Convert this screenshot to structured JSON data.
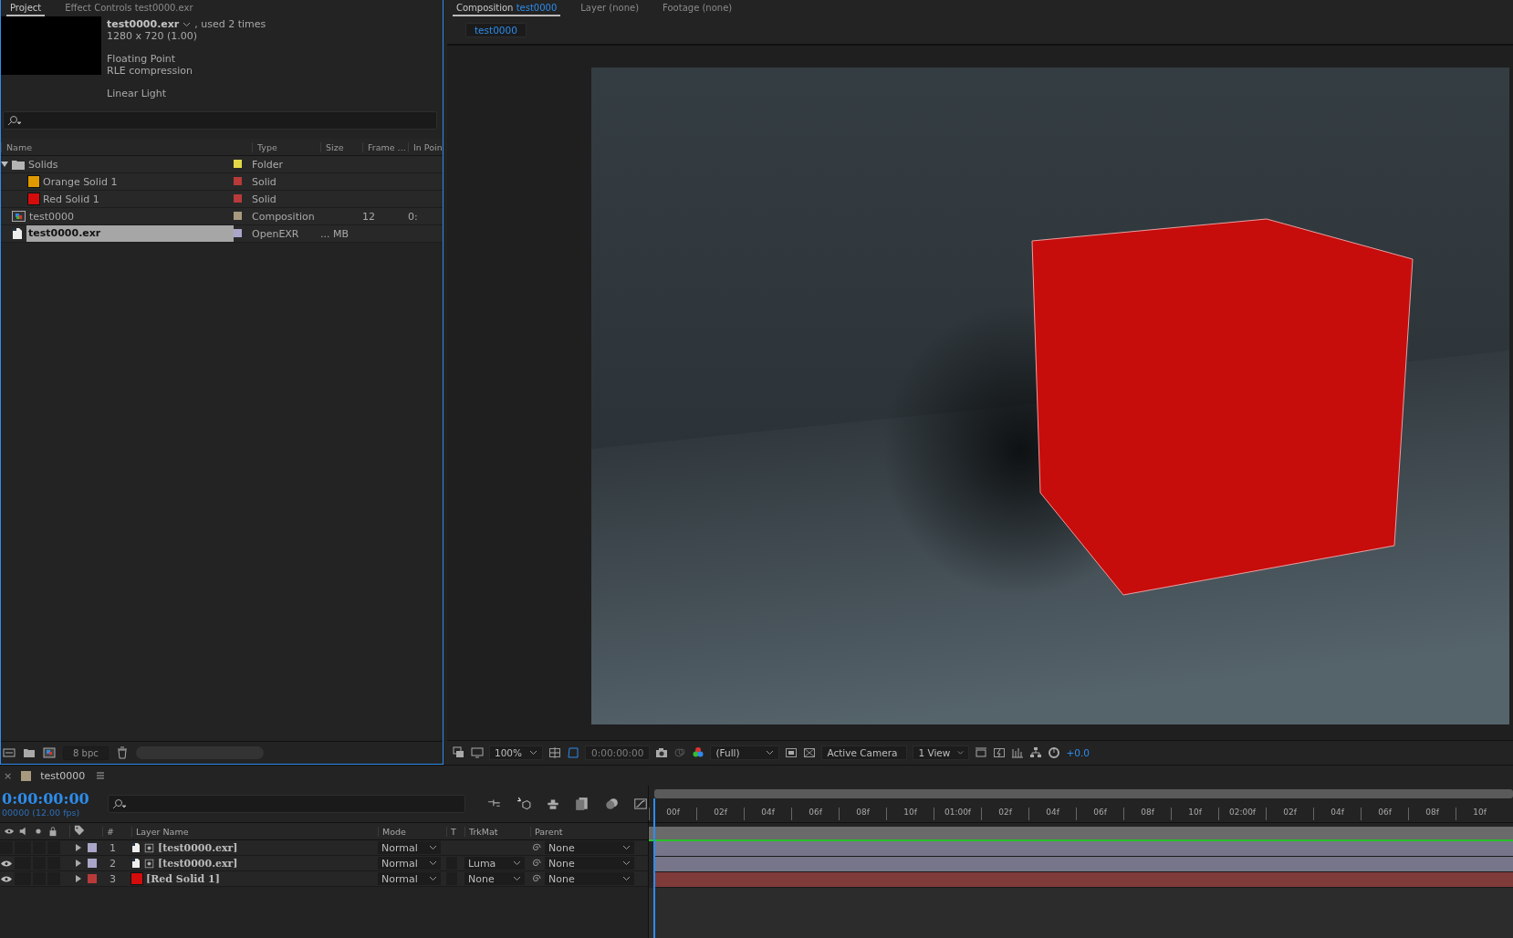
{
  "panel_tabs": [
    {
      "label": "Project",
      "selected": true
    },
    {
      "label": "Effect Controls test0000.exr",
      "selected": false
    }
  ],
  "viewer_tabs": [
    {
      "label": "Composition",
      "target": "test0000",
      "selected": true
    },
    {
      "label": "Layer (none)",
      "selected": false
    },
    {
      "label": "Footage (none)",
      "selected": false
    }
  ],
  "footage_info": {
    "name": "test0000.exr",
    "usage": ", used 2 times",
    "line_groups": [
      [
        "1280 x 720 (1.00)"
      ],
      [
        "Floating Point",
        "RLE compression"
      ],
      [
        "Linear Light"
      ]
    ]
  },
  "project": {
    "columns": [
      "Name",
      "Type",
      "Size",
      "Frame ...",
      "In Poin"
    ],
    "items": [
      {
        "name": "Solids",
        "kind": "folder",
        "expanded": true,
        "color": "#e2d847",
        "type": "Folder",
        "selected": false,
        "children": [
          {
            "name": "Orange Solid 1",
            "kind": "solid",
            "swatch": {
              "color": "#e09a00"
            },
            "color": "#b83a3a",
            "type": "Solid",
            "selected": false
          },
          {
            "name": "Red Solid 1",
            "kind": "solid",
            "swatch": {
              "color": "#d40c0c"
            },
            "color": "#b83a3a",
            "type": "Solid",
            "selected": false
          }
        ]
      },
      {
        "name": "test0000",
        "kind": "composition",
        "color": "#a89a7e",
        "type": "Composition",
        "frame_rate": "12",
        "in_point": "0:",
        "selected": false
      },
      {
        "name": "test0000.exr",
        "kind": "footage",
        "color": "#a9a6c9",
        "type": "OpenEXR",
        "size": "... MB",
        "selected": true
      }
    ],
    "bit_depth": "8 bpc"
  },
  "composition": {
    "breadcrumb": "test0000",
    "zoom": "100%",
    "timecode": "0:00:00:00",
    "resolution": "(Full)",
    "camera": "Active Camera",
    "views": "1 View",
    "exposure": "+0.0"
  },
  "timeline": {
    "tab": {
      "close": "×",
      "label": "test0000",
      "color": "#a89a7e"
    },
    "timecode": "0:00:00:00",
    "frame_info": "00000 (12.00 fps)",
    "columns": [
      "#",
      "Layer Name",
      "Mode",
      "T",
      "TrkMat",
      "Parent"
    ],
    "layers": [
      {
        "number": "1",
        "name": "[test0000.exr]",
        "kind": "footage",
        "color": "#a9a6c9",
        "visible": false,
        "mode": "Normal",
        "parent": "None"
      },
      {
        "number": "2",
        "name": "[test0000.exr]",
        "kind": "footage",
        "color": "#a9a6c9",
        "visible": true,
        "mode": "Normal",
        "trkmat": "Luma",
        "parent": "None"
      },
      {
        "number": "3",
        "name": "[Red Solid 1]",
        "kind": "solid",
        "swatch": {
          "color": "#d40c0c"
        },
        "color": "#b83a3a",
        "visible": true,
        "mode": "Normal",
        "trkmat": "None",
        "parent": "None"
      }
    ],
    "ruler": [
      "00f",
      "02f",
      "04f",
      "06f",
      "08f",
      "10f",
      "01:00f",
      "02f",
      "04f",
      "06f",
      "08f",
      "10f",
      "02:00f",
      "02f",
      "04f",
      "06f",
      "08f",
      "10f"
    ]
  }
}
